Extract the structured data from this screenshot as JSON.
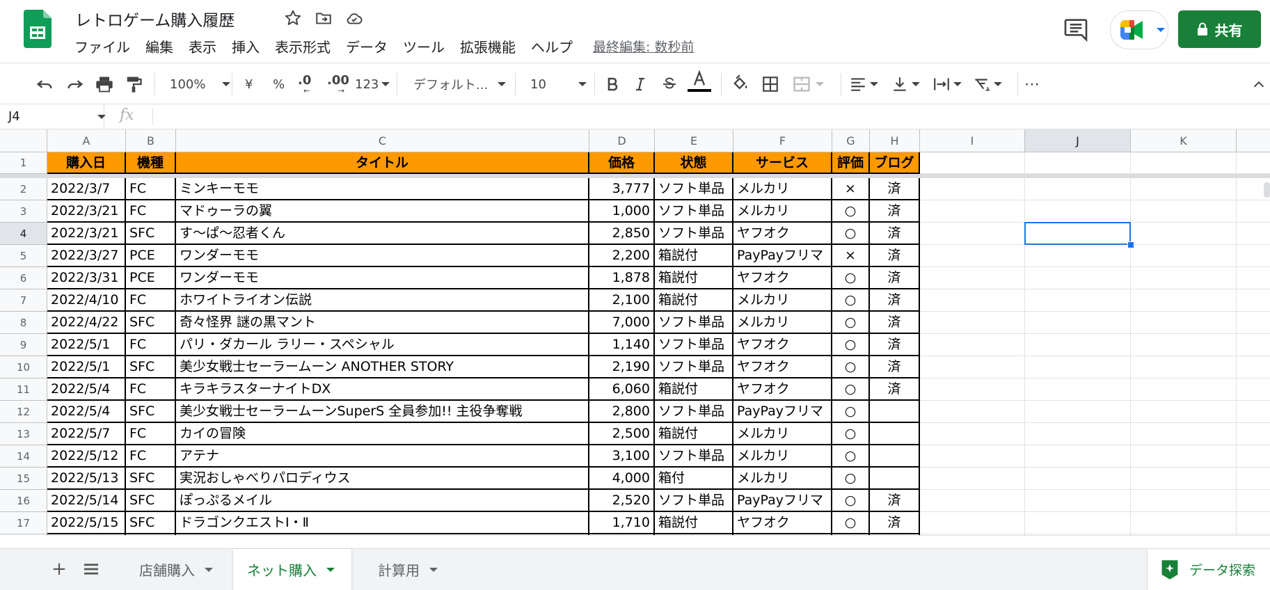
{
  "app": {
    "doc_title": "レトロゲーム購入履歴",
    "menu": [
      "ファイル",
      "編集",
      "表示",
      "挿入",
      "表示形式",
      "データ",
      "ツール",
      "拡張機能",
      "ヘルプ"
    ],
    "last_edit": "最終編集: 数秒前",
    "share_label": "共有"
  },
  "toolbar": {
    "zoom": "100%",
    "currency": "¥",
    "percent": "%",
    "dec_decrease": ".0",
    "dec_increase": ".00",
    "number_format": "123",
    "font": "デフォルト...",
    "font_size": "10",
    "more": "⋯"
  },
  "formula_bar": {
    "name_box": "J4",
    "fx": "fx"
  },
  "grid": {
    "columns": [
      "A",
      "B",
      "C",
      "D",
      "E",
      "F",
      "G",
      "H",
      "I",
      "J",
      "K"
    ],
    "selected_column": "J",
    "selected_row": 4,
    "active_cell": "J4",
    "header_row": {
      "row": "1",
      "cells": [
        "購入日",
        "機種",
        "タイトル",
        "価格",
        "状態",
        "サービス",
        "評価",
        "ブログ"
      ]
    },
    "rows": [
      {
        "row": "2",
        "cells": [
          "2022/3/7",
          "FC",
          "ミンキーモモ",
          "3,777",
          "ソフト単品",
          "メルカリ",
          "×",
          "済"
        ]
      },
      {
        "row": "3",
        "cells": [
          "2022/3/21",
          "FC",
          "マドゥーラの翼",
          "1,000",
          "ソフト単品",
          "メルカリ",
          "○",
          "済"
        ]
      },
      {
        "row": "4",
        "cells": [
          "2022/3/21",
          "SFC",
          "す～ぱ～忍者くん",
          "2,850",
          "ソフト単品",
          "ヤフオク",
          "○",
          "済"
        ]
      },
      {
        "row": "5",
        "cells": [
          "2022/3/27",
          "PCE",
          "ワンダーモモ",
          "2,200",
          "箱説付",
          "PayPayフリマ",
          "×",
          "済"
        ]
      },
      {
        "row": "6",
        "cells": [
          "2022/3/31",
          "PCE",
          "ワンダーモモ",
          "1,878",
          "箱説付",
          "ヤフオク",
          "○",
          "済"
        ]
      },
      {
        "row": "7",
        "cells": [
          "2022/4/10",
          "FC",
          "ホワイトライオン伝説",
          "2,100",
          "箱説付",
          "メルカリ",
          "○",
          "済"
        ]
      },
      {
        "row": "8",
        "cells": [
          "2022/4/22",
          "SFC",
          "奇々怪界 謎の黒マント",
          "7,000",
          "ソフト単品",
          "メルカリ",
          "○",
          "済"
        ]
      },
      {
        "row": "9",
        "cells": [
          "2022/5/1",
          "FC",
          "パリ・ダカール ラリー・スペシャル",
          "1,140",
          "ソフト単品",
          "ヤフオク",
          "○",
          "済"
        ]
      },
      {
        "row": "10",
        "cells": [
          "2022/5/1",
          "SFC",
          "美少女戦士セーラームーン ANOTHER STORY",
          "2,190",
          "ソフト単品",
          "ヤフオク",
          "○",
          "済"
        ]
      },
      {
        "row": "11",
        "cells": [
          "2022/5/4",
          "FC",
          "キラキラスターナイトDX",
          "6,060",
          "箱説付",
          "ヤフオク",
          "○",
          "済"
        ]
      },
      {
        "row": "12",
        "cells": [
          "2022/5/4",
          "SFC",
          "美少女戦士セーラームーンSuperS 全員参加!! 主役争奪戦",
          "2,800",
          "ソフト単品",
          "PayPayフリマ",
          "○",
          ""
        ]
      },
      {
        "row": "13",
        "cells": [
          "2022/5/7",
          "FC",
          "カイの冒険",
          "2,500",
          "箱説付",
          "メルカリ",
          "○",
          ""
        ]
      },
      {
        "row": "14",
        "cells": [
          "2022/5/12",
          "FC",
          "アテナ",
          "3,100",
          "ソフト単品",
          "メルカリ",
          "○",
          ""
        ]
      },
      {
        "row": "15",
        "cells": [
          "2022/5/13",
          "SFC",
          "実況おしゃべりパロディウス",
          "4,000",
          "箱付",
          "メルカリ",
          "○",
          ""
        ]
      },
      {
        "row": "16",
        "cells": [
          "2022/5/14",
          "SFC",
          "ぽっぷるメイル",
          "2,520",
          "ソフト単品",
          "PayPayフリマ",
          "○",
          "済"
        ]
      },
      {
        "row": "17",
        "cells": [
          "2022/5/15",
          "SFC",
          "ドラゴンクエストⅠ・Ⅱ",
          "1,710",
          "箱説付",
          "ヤフオク",
          "○",
          "済"
        ]
      }
    ]
  },
  "sheets": {
    "tabs": [
      "店舗購入",
      "ネット購入",
      "計算用"
    ],
    "active": "ネット購入",
    "explore_label": "データ探索"
  },
  "colors": {
    "header_fill": "#ff9900",
    "brand_green": "#188038",
    "selection_blue": "#1a73e8"
  }
}
